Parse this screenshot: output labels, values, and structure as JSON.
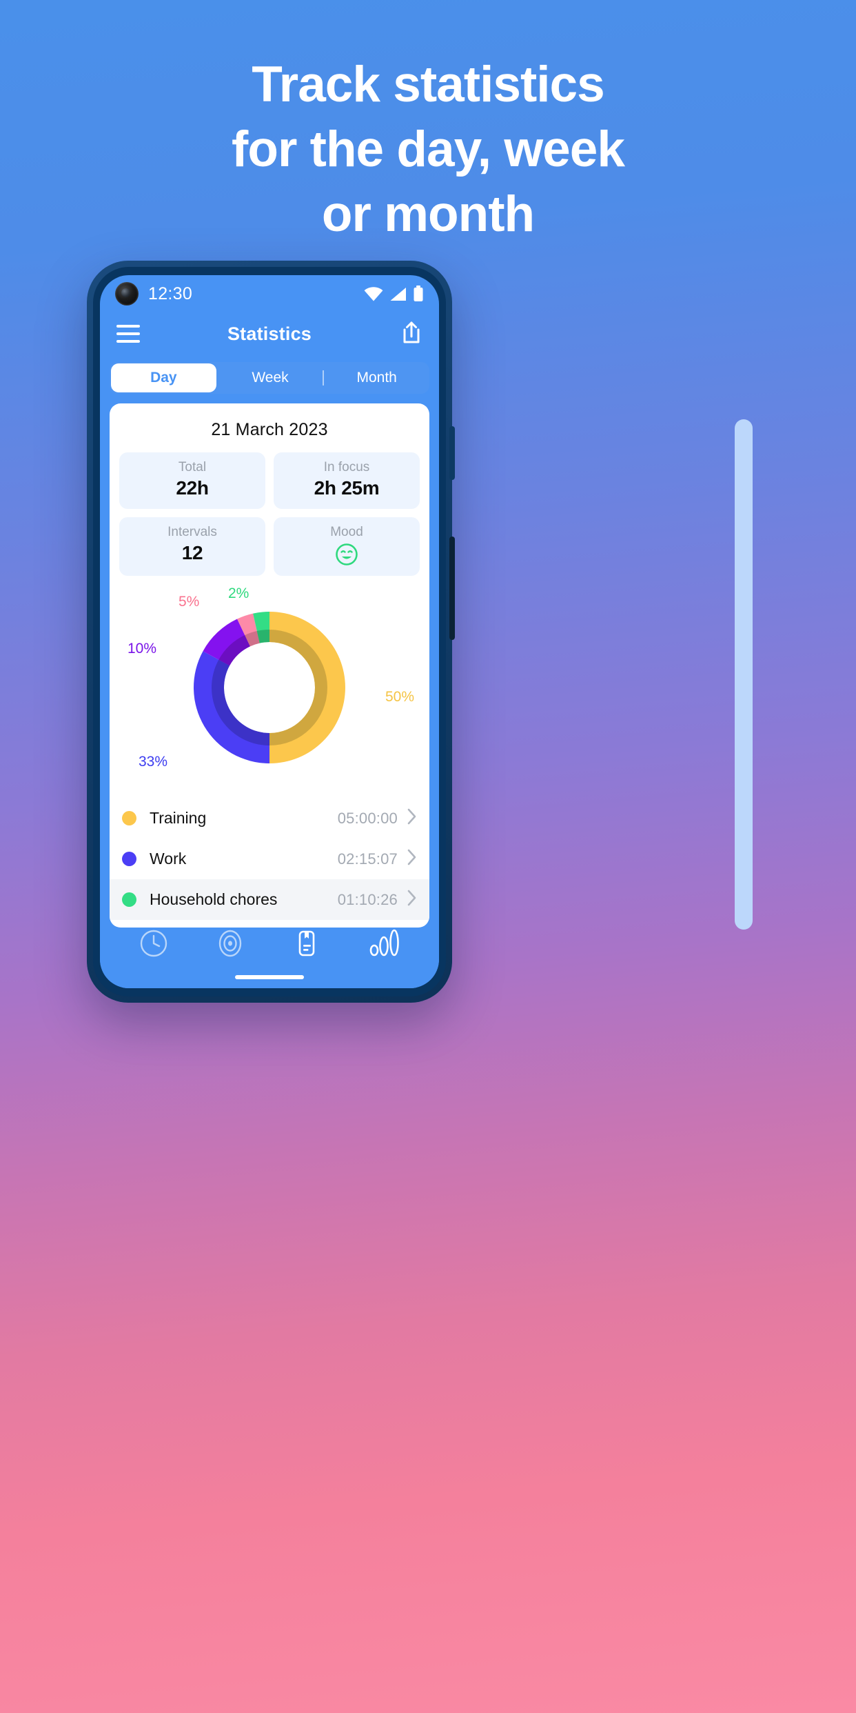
{
  "promo": {
    "headline_lines": [
      "Track statistics",
      "for the day, week",
      "or month"
    ]
  },
  "status_bar": {
    "time": "12:30",
    "icons": [
      "wifi-icon",
      "signal-icon",
      "battery-icon"
    ]
  },
  "app_bar": {
    "menu_icon": "hamburger-menu-icon",
    "title": "Statistics",
    "share_icon": "share-icon"
  },
  "tabs": {
    "items": [
      {
        "label": "Day",
        "active": true
      },
      {
        "label": "Week",
        "active": false
      },
      {
        "label": "Month",
        "active": false
      }
    ]
  },
  "card": {
    "date": "21 March 2023",
    "tiles": [
      {
        "label": "Total",
        "value": "22h"
      },
      {
        "label": "In focus",
        "value": "2h 25m"
      },
      {
        "label": "Intervals",
        "value": "12"
      },
      {
        "label": "Mood",
        "value": "",
        "icon": "smiley-face-icon"
      }
    ]
  },
  "chart_data": {
    "type": "pie",
    "title": "",
    "categories": [
      "Training",
      "Work",
      "Unlabeled purple",
      "Unlabeled pink",
      "Household chores"
    ],
    "values": [
      50,
      33,
      10,
      5,
      2
    ],
    "labels": [
      "50%",
      "33%",
      "10%",
      "5%",
      "2%"
    ],
    "colors": [
      "#fcc74c",
      "#4b3ef5",
      "#8412ef",
      "#fd8aa8",
      "#33dd85"
    ],
    "shadow_colors": [
      "#cda53e",
      "#3b31c4",
      "#6a0fbe",
      "#cc6f87",
      "#29b06a"
    ],
    "units": "percent",
    "legend_position": "below",
    "grid": false
  },
  "legend": {
    "rows": [
      {
        "name": "Training",
        "time": "05:00:00",
        "color": "#fcc74c"
      },
      {
        "name": "Work",
        "time": "02:15:07",
        "color": "#4b3ef5"
      },
      {
        "name": "Household chores",
        "time": "01:10:26",
        "color": "#33dd85"
      }
    ],
    "chevron_icon": "chevron-right-icon"
  },
  "bottom_nav": {
    "items": [
      {
        "icon": "clock-icon",
        "active": false
      },
      {
        "icon": "target-icon",
        "active": false
      },
      {
        "icon": "report-icon",
        "active": true
      },
      {
        "icon": "bar-chart-icon",
        "active": true
      }
    ]
  },
  "colors": {
    "accent": "#4893f4",
    "tab_track": "#4e95f2",
    "tile_bg": "#edf4fe",
    "phone_frame": "#0d3258"
  }
}
